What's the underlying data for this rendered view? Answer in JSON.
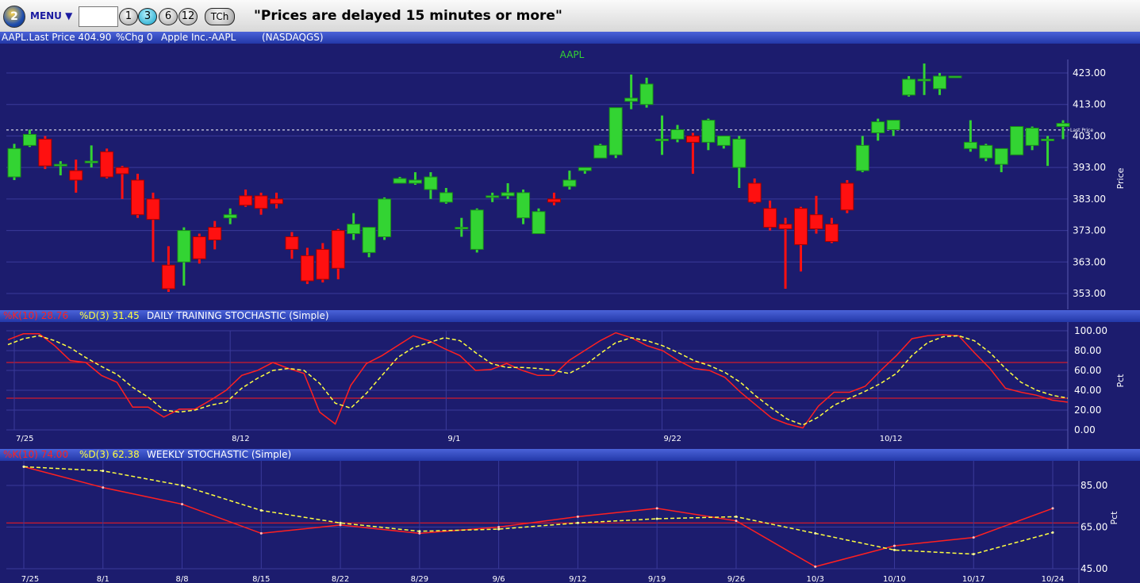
{
  "toolbar": {
    "logo": "2",
    "menu_label": "MENU ▼",
    "symbol_value": "",
    "period_buttons": [
      "1",
      "3",
      "6",
      "12"
    ],
    "active_period": "3",
    "tch_label": "TCh",
    "notice": "\"Prices are delayed 15 minutes or more\""
  },
  "info": {
    "symbol_price": "AAPL.Last Price 404.90",
    "pct_change": "%Chg 0",
    "company": "Apple Inc.-AAPL",
    "exchange": "(NASDAQGS)"
  },
  "colors": {
    "background": "#1c1c6e",
    "up": "#33d433",
    "down": "#ff1010",
    "k_line": "#ff2020",
    "d_line": "#ffff40"
  },
  "price_panel": {
    "title": "AAPL",
    "ylabel": "Price",
    "last_price_label": "Last Price"
  },
  "daily_panel": {
    "k_label": "%K(10) 28.76",
    "d_label": "%D(3) 31.45",
    "title": "DAILY TRAINING STOCHASTIC (Simple)",
    "ylabel": "Pct"
  },
  "weekly_panel": {
    "k_label": "%K(10) 74.00",
    "d_label": "%D(3) 62.38",
    "title": "WEEKLY STOCHASTIC (Simple)",
    "ylabel": "Pct"
  },
  "chart_data": [
    {
      "type": "candlestick",
      "title": "AAPL",
      "ylabel": "Price",
      "ylim": [
        353,
        423
      ],
      "y_ticks": [
        "353.00",
        "363.00",
        "373.00",
        "383.00",
        "393.00",
        "403.00",
        "413.00",
        "423.00"
      ],
      "last_price": 404.9,
      "x_labels": [],
      "candles": [
        {
          "o": 390,
          "h": 400.5,
          "l": 389,
          "c": 399
        },
        {
          "o": 400,
          "h": 405,
          "l": 399.5,
          "c": 403.5
        },
        {
          "o": 402,
          "h": 403,
          "l": 392.5,
          "c": 393.5
        },
        {
          "o": 394,
          "h": 395,
          "l": 390.5,
          "c": 394
        },
        {
          "o": 392,
          "h": 395.5,
          "l": 385,
          "c": 389
        },
        {
          "o": 395,
          "h": 400,
          "l": 393,
          "c": 395
        },
        {
          "o": 398,
          "h": 399,
          "l": 389.5,
          "c": 390
        },
        {
          "o": 393,
          "h": 393.5,
          "l": 383,
          "c": 391
        },
        {
          "o": 389,
          "h": 391,
          "l": 377,
          "c": 378
        },
        {
          "o": 383,
          "h": 385,
          "l": 363,
          "c": 376.5
        },
        {
          "o": 362,
          "h": 368,
          "l": 353.5,
          "c": 354.5
        },
        {
          "o": 363,
          "h": 374,
          "l": 355.5,
          "c": 373
        },
        {
          "o": 371,
          "h": 372,
          "l": 362.5,
          "c": 364
        },
        {
          "o": 374,
          "h": 376,
          "l": 367,
          "c": 370
        },
        {
          "o": 377,
          "h": 380,
          "l": 375,
          "c": 378
        },
        {
          "o": 384,
          "h": 386,
          "l": 380.5,
          "c": 381
        },
        {
          "o": 384,
          "h": 385,
          "l": 378,
          "c": 380
        },
        {
          "o": 383,
          "h": 385,
          "l": 380,
          "c": 381.5
        },
        {
          "o": 371,
          "h": 372.5,
          "l": 364,
          "c": 367
        },
        {
          "o": 365,
          "h": 367.5,
          "l": 356,
          "c": 357
        },
        {
          "o": 367,
          "h": 369,
          "l": 356.5,
          "c": 357.5
        },
        {
          "o": 373,
          "h": 373.5,
          "l": 357.5,
          "c": 361
        },
        {
          "o": 372,
          "h": 378.5,
          "l": 370,
          "c": 375
        },
        {
          "o": 366,
          "h": 374,
          "l": 364.5,
          "c": 374
        },
        {
          "o": 371,
          "h": 383.5,
          "l": 370,
          "c": 383
        },
        {
          "o": 388,
          "h": 390,
          "l": 388,
          "c": 389.5
        },
        {
          "o": 388,
          "h": 391.5,
          "l": 387.5,
          "c": 389
        },
        {
          "o": 386,
          "h": 391.5,
          "l": 383,
          "c": 390
        },
        {
          "o": 382,
          "h": 386.5,
          "l": 381.5,
          "c": 385
        },
        {
          "o": 374,
          "h": 377,
          "l": 371,
          "c": 374
        },
        {
          "o": 367,
          "h": 380,
          "l": 366,
          "c": 379.5
        },
        {
          "o": 384,
          "h": 385,
          "l": 382,
          "c": 384
        },
        {
          "o": 384,
          "h": 388,
          "l": 383,
          "c": 385
        },
        {
          "o": 377,
          "h": 386,
          "l": 375,
          "c": 385
        },
        {
          "o": 372,
          "h": 380,
          "l": 372,
          "c": 379
        },
        {
          "o": 383,
          "h": 385,
          "l": 381,
          "c": 382
        },
        {
          "o": 387,
          "h": 392,
          "l": 386,
          "c": 389
        },
        {
          "o": 392,
          "h": 393,
          "l": 391,
          "c": 393
        },
        {
          "o": 396,
          "h": 400.5,
          "l": 396,
          "c": 400
        },
        {
          "o": 397,
          "h": 412,
          "l": 396,
          "c": 412
        },
        {
          "o": 414,
          "h": 422.5,
          "l": 411.5,
          "c": 415
        },
        {
          "o": 413,
          "h": 421.5,
          "l": 412,
          "c": 419.5
        },
        {
          "o": 402,
          "h": 409.5,
          "l": 397,
          "c": 402
        },
        {
          "o": 402,
          "h": 406.5,
          "l": 401,
          "c": 405
        },
        {
          "o": 403,
          "h": 404,
          "l": 391,
          "c": 401
        },
        {
          "o": 401,
          "h": 408.5,
          "l": 398.5,
          "c": 408
        },
        {
          "o": 400,
          "h": 403,
          "l": 399,
          "c": 403
        },
        {
          "o": 393,
          "h": 403,
          "l": 386.5,
          "c": 402
        },
        {
          "o": 388,
          "h": 389.5,
          "l": 381.5,
          "c": 382
        },
        {
          "o": 380,
          "h": 382.5,
          "l": 373,
          "c": 374
        },
        {
          "o": 375,
          "h": 377,
          "l": 354.5,
          "c": 373.5
        },
        {
          "o": 380,
          "h": 380.5,
          "l": 360,
          "c": 368.5
        },
        {
          "o": 378,
          "h": 384,
          "l": 372,
          "c": 373.5
        },
        {
          "o": 375,
          "h": 377,
          "l": 369,
          "c": 369.5
        },
        {
          "o": 388,
          "h": 389,
          "l": 378.5,
          "c": 379.5
        },
        {
          "o": 392,
          "h": 403,
          "l": 391.5,
          "c": 400
        },
        {
          "o": 404,
          "h": 408.5,
          "l": 401.5,
          "c": 407.5
        },
        {
          "o": 405,
          "h": 408,
          "l": 403,
          "c": 408
        },
        {
          "o": 416,
          "h": 422,
          "l": 415.5,
          "c": 421
        },
        {
          "o": 421,
          "h": 426,
          "l": 416,
          "c": 421
        },
        {
          "o": 418,
          "h": 423,
          "l": 416,
          "c": 422
        },
        {
          "o": 422,
          "h": 422,
          "l": 422,
          "c": 422
        },
        {
          "o": 399,
          "h": 408,
          "l": 398,
          "c": 401
        },
        {
          "o": 396,
          "h": 400.5,
          "l": 395,
          "c": 400
        },
        {
          "o": 394,
          "h": 399,
          "l": 391.5,
          "c": 399
        },
        {
          "o": 397,
          "h": 406,
          "l": 397,
          "c": 406
        },
        {
          "o": 400,
          "h": 406,
          "l": 398.5,
          "c": 405.5
        },
        {
          "o": 402,
          "h": 403,
          "l": 393.5,
          "c": 402
        },
        {
          "o": 406,
          "h": 408,
          "l": 402,
          "c": 407
        }
      ]
    },
    {
      "type": "line",
      "title": "DAILY TRAINING STOCHASTIC (Simple)",
      "ylabel": "Pct",
      "ylim": [
        0,
        100
      ],
      "y_ticks": [
        "0.00",
        "20.00",
        "40.00",
        "60.00",
        "80.00",
        "100.00"
      ],
      "reference_lines": [
        32,
        68
      ],
      "x_labels": [
        "7/25",
        "8/12",
        "9/1",
        "9/22",
        "10/12"
      ],
      "series": [
        {
          "name": "%K(10) 28.76",
          "style": "solid",
          "values": [
            91,
            97,
            97,
            85,
            70,
            68,
            55,
            48,
            23,
            23,
            13,
            21,
            21,
            30,
            40,
            55,
            60,
            68,
            62,
            57,
            18,
            6,
            45,
            67,
            75,
            85,
            95,
            90,
            82,
            75,
            60,
            61,
            67,
            60,
            55,
            55,
            70,
            80,
            90,
            98,
            93,
            85,
            80,
            70,
            62,
            60,
            53,
            38,
            25,
            12,
            6,
            2,
            24,
            38,
            38,
            44,
            60,
            75,
            92,
            95,
            96,
            95,
            78,
            62,
            42,
            38,
            35,
            30,
            28
          ]
        },
        {
          "name": "%D(3) 31.45",
          "style": "dashed",
          "values": [
            86,
            92,
            95,
            90,
            83,
            73,
            64,
            56,
            43,
            33,
            20,
            18,
            20,
            25,
            28,
            42,
            52,
            60,
            62,
            60,
            47,
            27,
            22,
            37,
            55,
            73,
            83,
            88,
            93,
            90,
            78,
            67,
            63,
            63,
            62,
            60,
            57,
            65,
            77,
            88,
            93,
            90,
            85,
            78,
            70,
            65,
            58,
            48,
            34,
            22,
            11,
            5,
            13,
            25,
            32,
            39,
            47,
            57,
            75,
            88,
            94,
            95,
            90,
            78,
            62,
            48,
            40,
            35,
            32
          ]
        }
      ]
    },
    {
      "type": "line",
      "title": "WEEKLY STOCHASTIC (Simple)",
      "ylabel": "Pct",
      "ylim": [
        45,
        85
      ],
      "y_ticks": [
        "45.00",
        "65.00",
        "85.00"
      ],
      "reference_lines": [
        67
      ],
      "x_labels": [
        "7/25",
        "8/1",
        "8/8",
        "8/15",
        "8/22",
        "8/29",
        "9/6",
        "9/12",
        "9/19",
        "9/26",
        "10/3",
        "10/10",
        "10/17",
        "10/24"
      ],
      "series": [
        {
          "name": "%K(10) 74.00",
          "style": "solid",
          "values": [
            94,
            84,
            76,
            62,
            66,
            62,
            65,
            70,
            74,
            68,
            46,
            56,
            60,
            74
          ]
        },
        {
          "name": "%D(3) 62.38",
          "style": "dashed",
          "values": [
            94,
            92,
            85,
            73,
            67,
            63,
            64,
            67,
            69,
            70,
            62,
            54,
            52,
            62.4
          ]
        }
      ]
    }
  ]
}
